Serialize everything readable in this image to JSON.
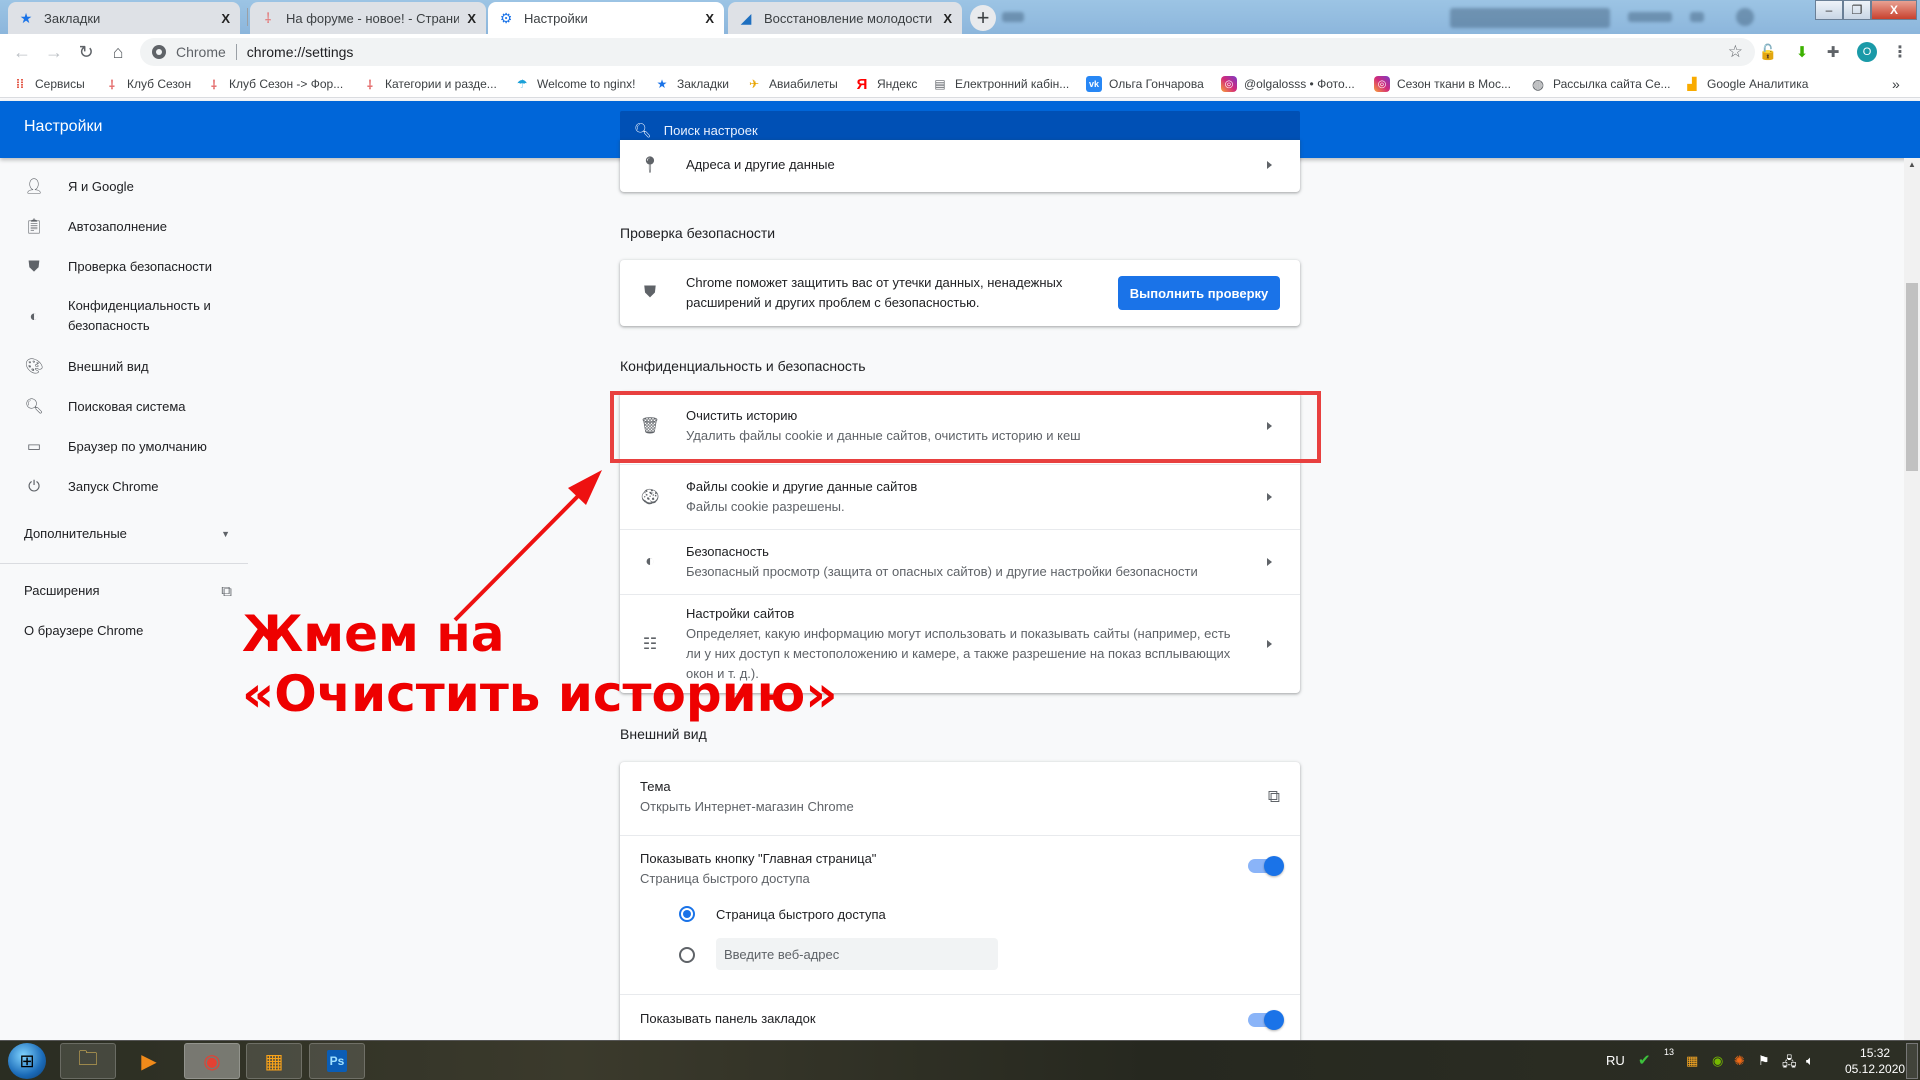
{
  "browser": {
    "tabs": [
      {
        "title": "Закладки",
        "icon": "star-icon",
        "active": false
      },
      {
        "title": "На форуме - новое! - Страница",
        "icon": "club-sezon-icon",
        "active": false
      },
      {
        "title": "Настройки",
        "icon": "gear-icon",
        "active": true
      },
      {
        "title": "Восстановление молодости лиц",
        "icon": "site-favicon-icon",
        "active": false
      }
    ],
    "new_tab": "+",
    "close_glyph": "X",
    "window_controls": {
      "minimize": "–",
      "maximize": "❐",
      "close": "X"
    },
    "omnibox": {
      "site_label": "Chrome",
      "url": "chrome://settings"
    },
    "avatar_letter": "O",
    "bookmarks": [
      {
        "label": "Сервисы",
        "icon": "apps-grid-icon"
      },
      {
        "label": "Клуб Сезон",
        "icon": "club-sezon-icon"
      },
      {
        "label": "Клуб Сезон -> Фор...",
        "icon": "club-sezon-icon"
      },
      {
        "label": "Категории и разде...",
        "icon": "club-sezon-icon"
      },
      {
        "label": "Welcome to nginx!",
        "icon": "umbrella-icon"
      },
      {
        "label": "Закладки",
        "icon": "star-icon"
      },
      {
        "label": "Авиабилеты",
        "icon": "plane-icon"
      },
      {
        "label": "Яндекс",
        "icon": "yandex-icon"
      },
      {
        "label": "Електронний кабін...",
        "icon": "document-icon"
      },
      {
        "label": "Ольга Гончарова",
        "icon": "vk-icon"
      },
      {
        "label": "@olgalosss • Фото...",
        "icon": "instagram-icon"
      },
      {
        "label": "Сезон ткани в Мос...",
        "icon": "instagram-icon"
      },
      {
        "label": "Рассылка сайта Се...",
        "icon": "globe-icon"
      },
      {
        "label": "Google Аналитика",
        "icon": "analytics-icon"
      }
    ],
    "bookmarks_overflow": "»"
  },
  "settings": {
    "title": "Настройки",
    "search_placeholder": "Поиск настроек",
    "sidebar": [
      {
        "label": "Я и Google",
        "icon": "person-icon"
      },
      {
        "label": "Автозаполнение",
        "icon": "clipboard-icon"
      },
      {
        "label": "Проверка безопасности",
        "icon": "shield-check-icon"
      },
      {
        "label": "Конфиденциальность и безопасность",
        "icon": "shield-half-icon"
      },
      {
        "label": "Внешний вид",
        "icon": "palette-icon"
      },
      {
        "label": "Поисковая система",
        "icon": "search-icon"
      },
      {
        "label": "Браузер по умолчанию",
        "icon": "browser-window-icon"
      },
      {
        "label": "Запуск Chrome",
        "icon": "power-icon"
      }
    ],
    "advanced": "Дополнительные",
    "extensions": "Расширения",
    "about": "О браузере Chrome",
    "addresses_row": "Адреса и другие данные",
    "safety_check": {
      "section_title": "Проверка безопасности",
      "text": "Chrome поможет защитить вас от утечки данных, ненадежных расширений и других проблем с безопасностью.",
      "button": "Выполнить проверку"
    },
    "privacy": {
      "section_title": "Конфиденциальность и безопасность",
      "rows": [
        {
          "title": "Очистить историю",
          "subtitle": "Удалить файлы cookie и данные сайтов, очистить историю и кеш",
          "icon": "trash-icon"
        },
        {
          "title": "Файлы cookie и другие данные сайтов",
          "subtitle": "Файлы cookie разрешены.",
          "icon": "cookie-icon"
        },
        {
          "title": "Безопасность",
          "subtitle": "Безопасный просмотр (защита от опасных сайтов) и другие настройки безопасности",
          "icon": "shield-half-icon"
        },
        {
          "title": "Настройки сайтов",
          "subtitle": "Определяет, какую информацию могут использовать и показывать сайты (например, есть ли у них доступ к местоположению и камере, а также разрешение на показ всплывающих окон и т. д.).",
          "icon": "sliders-icon"
        }
      ]
    },
    "appearance": {
      "section_title": "Внешний вид",
      "theme_title": "Тема",
      "theme_subtitle": "Открыть Интернет-магазин Chrome",
      "home_button_title": "Показывать кнопку \"Главная страница\"",
      "home_button_subtitle": "Страница быстрого доступа",
      "home_button_enabled": true,
      "radio_option_1": "Страница быстрого доступа",
      "radio_option_1_selected": true,
      "url_placeholder": "Введите веб-адрес",
      "bookmarks_bar_title": "Показывать панель закладок",
      "bookmarks_bar_enabled": true
    }
  },
  "annotation": {
    "line1": "Жмем на",
    "line2": "«Очистить историю»",
    "color": "#ee0000"
  },
  "taskbar": {
    "apps": [
      "file-explorer-icon",
      "media-player-icon",
      "chrome-icon",
      "firewall-icon",
      "photoshop-icon"
    ],
    "language": "RU",
    "tray_badge": "13",
    "time": "15:32",
    "date": "05.12.2020"
  }
}
